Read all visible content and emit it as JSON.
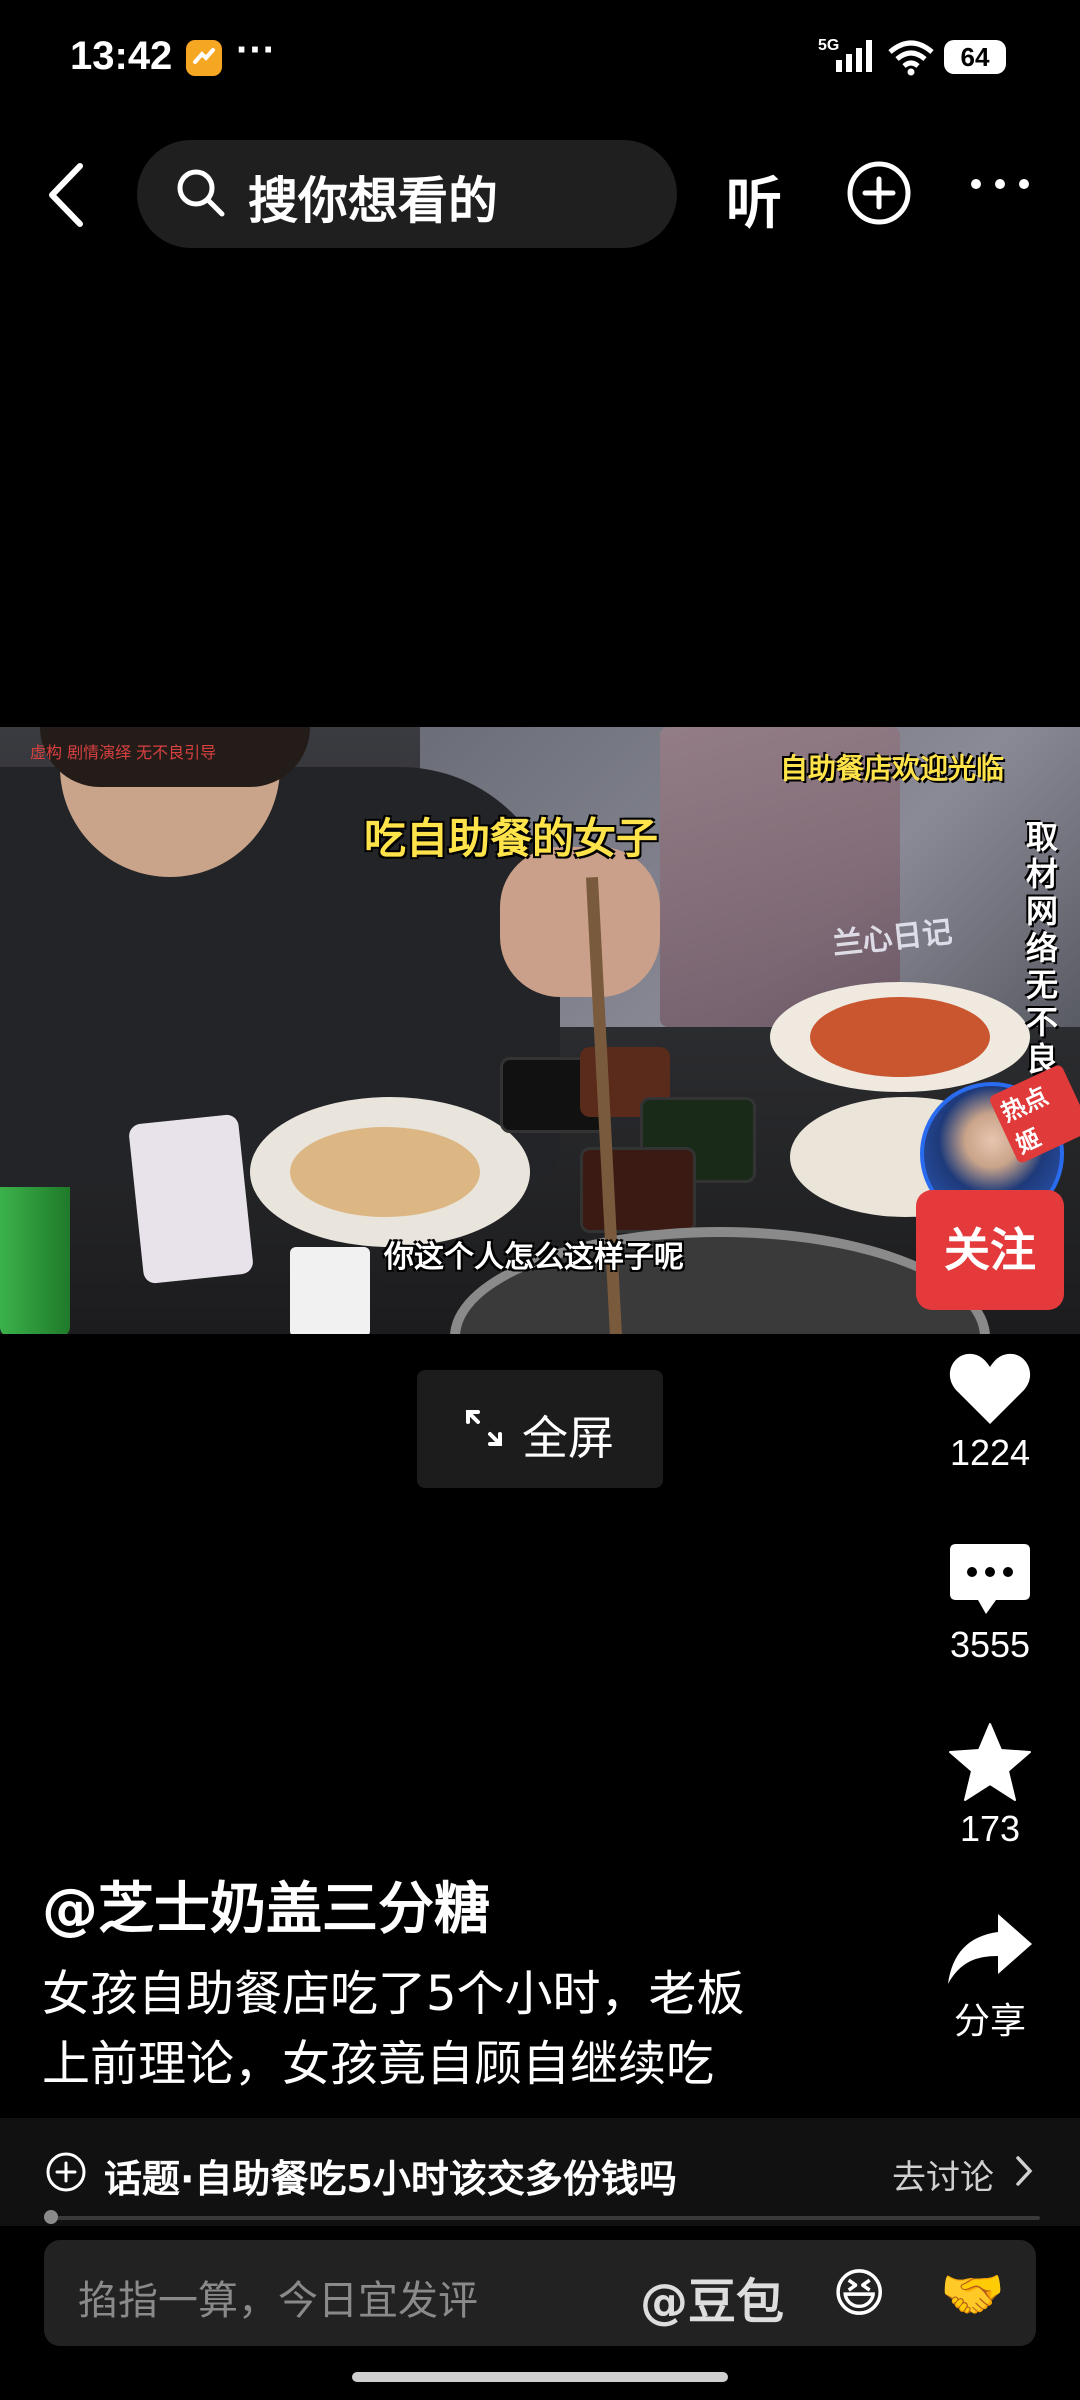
{
  "status_bar": {
    "time": "13:42",
    "dots": "···",
    "network": "5G",
    "battery": "64"
  },
  "top_nav": {
    "search_placeholder": "搜你想看的",
    "listen_label": "听"
  },
  "video": {
    "watermark": "虚构 剧情演绎 无不良引导",
    "title_caption": "吃自助餐的女子",
    "welcome_caption": "自助餐店欢迎光临",
    "logo_text": "兰心日记",
    "vertical_caption": "取材网络无不良引导",
    "subtitle": "你这个人怎么这样子呢",
    "hot_tag": "热点姬"
  },
  "follow_label": "关注",
  "fullscreen_label": "全屏",
  "actions": {
    "likes": "1224",
    "comments": "3555",
    "favorites": "173",
    "share_label": "分享"
  },
  "post": {
    "author": "@芝士奶盖三分糖",
    "desc_line1": "女孩自助餐店吃了5个小时，老板",
    "desc_line2": "上前理论，女孩竟自顾自继续吃"
  },
  "topic": {
    "text": "话题·自助餐吃5小时该交多份钱吗",
    "action": "去讨论"
  },
  "comment_input": {
    "placeholder": "掐指一算，今日宜发评",
    "mention": "@豆包",
    "emoji1": "😆",
    "emoji2": "🤝"
  },
  "colors": {
    "accent_red": "#e43a3c",
    "caption_yellow": "#ffe34a",
    "background": "#000000"
  }
}
